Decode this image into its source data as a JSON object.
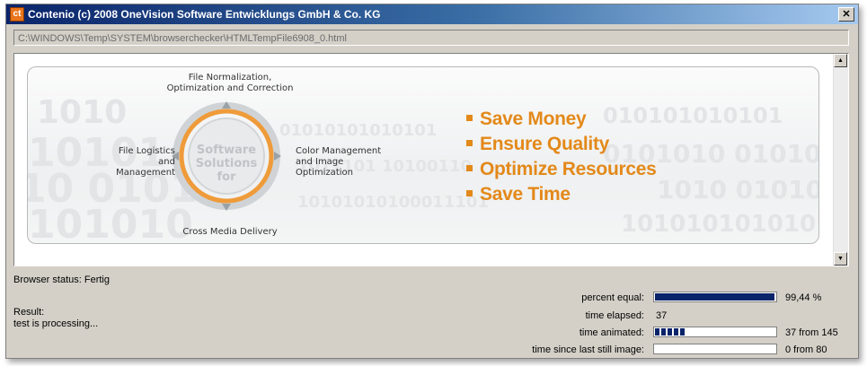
{
  "window": {
    "title": "Contenio (c) 2008 OneVision Software Entwicklungs GmbH & Co. KG",
    "icon_text": "ct",
    "close_label": "✕"
  },
  "url": "C:\\WINDOWS\\Temp\\SYSTEM\\browserchecker\\HTMLTempFile6908_0.html",
  "banner": {
    "top_label": "File Normalization,\nOptimization and Correction",
    "left_label": "File Logistics\nand Management",
    "center_label": "Software\nSolutions for",
    "right_label": "Color Management\nand Image Optimization",
    "bottom_label": "Cross Media Delivery",
    "benefits": [
      "Save Money",
      "Ensure Quality",
      "Optimize Resources",
      "Save Time"
    ],
    "accent": "#e3891a"
  },
  "browser_status": "Browser status: Fertig",
  "result": {
    "label": "Result:",
    "text": "test is processing..."
  },
  "stats": [
    {
      "label": "percent equal:",
      "type": "bar",
      "fraction": 0.9944,
      "segmented": false,
      "value": "99,44 %"
    },
    {
      "label": "time elapsed:",
      "type": "text",
      "value": "37"
    },
    {
      "label": "time animated:",
      "type": "bar",
      "fraction": 0.255,
      "segmented": true,
      "value": "37 from 145"
    },
    {
      "label": "time since last still image:",
      "type": "bar",
      "fraction": 0,
      "segmented": false,
      "value": "0 from 80"
    }
  ],
  "colors": {
    "title_bar": "#0a246a",
    "progress": "#0a246a",
    "window_bg": "#d4d0c8"
  }
}
